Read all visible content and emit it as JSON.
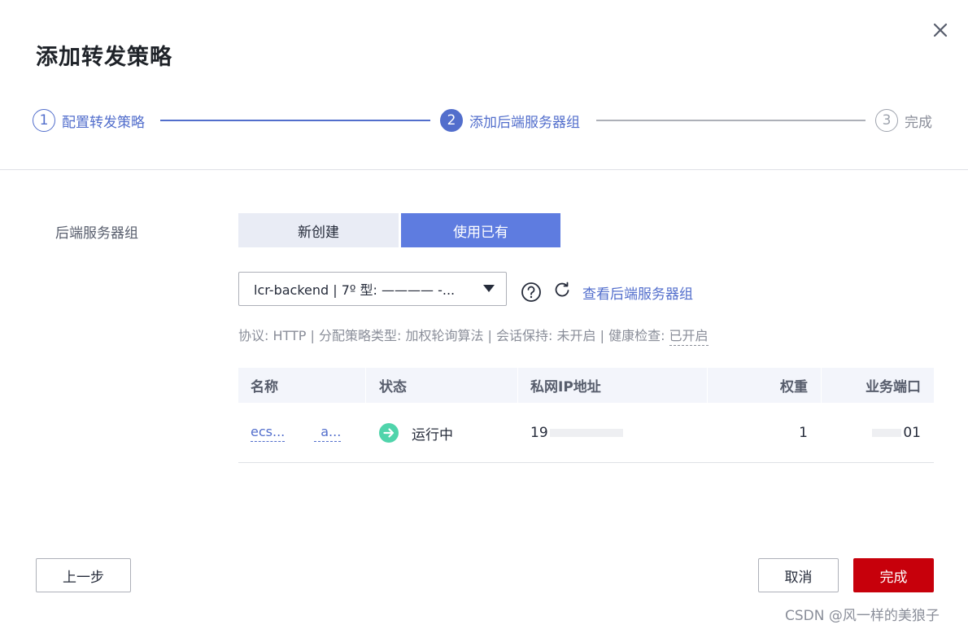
{
  "dialog": {
    "title": "添加转发策略",
    "close_icon": "close-icon"
  },
  "steps": [
    {
      "number": "1",
      "label": "配置转发策略",
      "state": "done"
    },
    {
      "number": "2",
      "label": "添加后端服务器组",
      "state": "active"
    },
    {
      "number": "3",
      "label": "完成",
      "state": "todo"
    }
  ],
  "form": {
    "backend_group_label": "后端服务器组",
    "segmented": {
      "new_label": "新创建",
      "existing_label": "使用已有",
      "selected": "existing"
    },
    "select": {
      "value": "lcr-backend | 7º 型: ———— -..."
    },
    "help_icon": "question-circle-icon",
    "refresh_icon": "refresh-icon",
    "view_link": "查看后端服务器组",
    "info": {
      "text": "协议: HTTP | 分配策略类型: 加权轮询算法 | 会话保持: 未开启 | 健康检查: ",
      "health_value": "已开启"
    }
  },
  "table": {
    "headers": [
      "名称",
      "状态",
      "私网IP地址",
      "权重",
      "业务端口"
    ],
    "rows": [
      {
        "name_part1": "ecs...",
        "name_part2": "a...",
        "status": "运行中",
        "ip": "19",
        "weight": "1",
        "port": "01"
      }
    ]
  },
  "footer": {
    "prev_label": "上一步",
    "cancel_label": "取消",
    "finish_label": "完成"
  },
  "watermark": "CSDN @风一样的美狼子",
  "colors": {
    "accent": "#526ecc",
    "primary_fill": "#5e7ce0",
    "danger": "#c7000b",
    "status_running": "#50d4ab"
  }
}
